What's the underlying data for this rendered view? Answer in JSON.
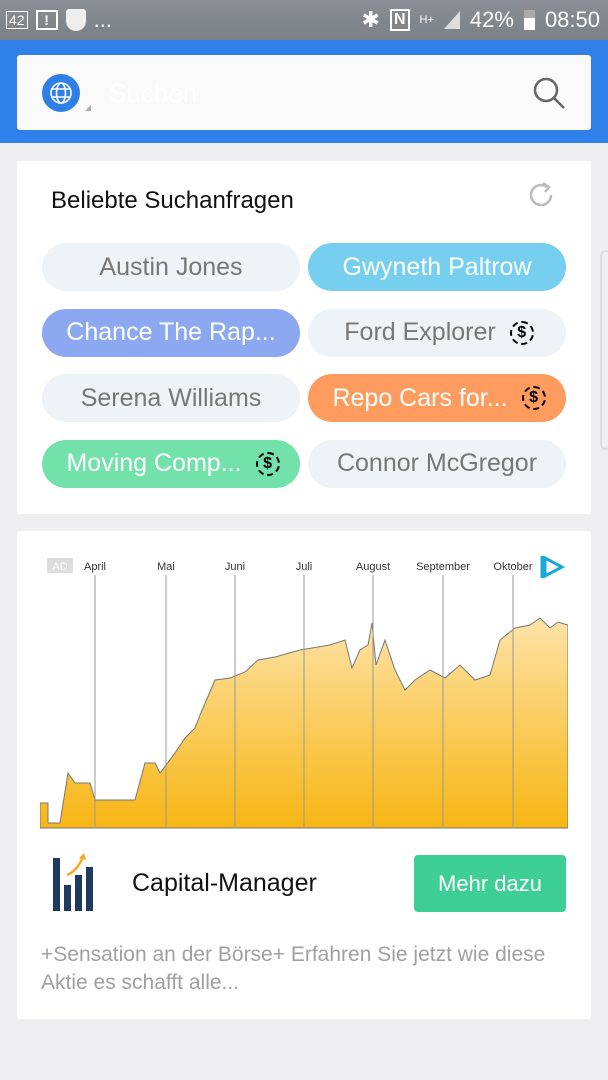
{
  "status_bar": {
    "notif_count": "42",
    "more": "...",
    "battery": "42%",
    "time": "08:50",
    "network": "H+"
  },
  "search": {
    "placeholder": "Suchen"
  },
  "popular": {
    "title": "Beliebte Suchanfragen",
    "chips": [
      {
        "label": "Austin Jones",
        "color": "#edf3f6",
        "sponsored": false
      },
      {
        "label": "Gwyneth Paltrow",
        "color": "#76cfee",
        "sponsored": false
      },
      {
        "label": "Chance The Rap...",
        "color": "#8ca8f0",
        "sponsored": false
      },
      {
        "label": "Ford Explorer",
        "color": "#edf3f6",
        "sponsored": true
      },
      {
        "label": "Serena Williams",
        "color": "#edf3f6",
        "sponsored": false
      },
      {
        "label": "Repo Cars for...",
        "color": "#fd9c5e",
        "sponsored": true
      },
      {
        "label": "Moving Comp...",
        "color": "#72e1aa",
        "sponsored": true
      },
      {
        "label": "Connor McGregor",
        "color": "#edf3f6",
        "sponsored": false
      }
    ]
  },
  "ad": {
    "badge": "AD",
    "months": [
      "April",
      "Mai",
      "Juni",
      "Juli",
      "August",
      "September",
      "Oktober"
    ],
    "brand": "Capital-Manager",
    "cta": "Mehr dazu",
    "description": "+Sensation an der Börse+  Erfahren Sie jetzt wie diese Aktie es schafft alle...",
    "fill_color": "#f7b614"
  }
}
